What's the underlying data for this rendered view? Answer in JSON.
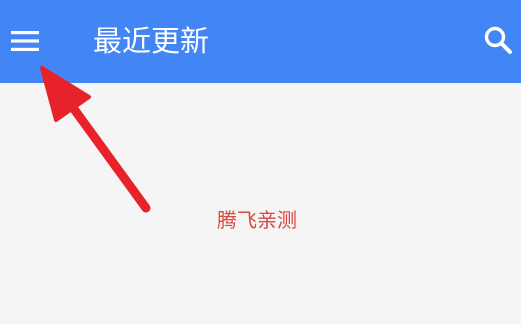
{
  "app_bar": {
    "title": "最近更新",
    "background_color": "#4285f4",
    "menu_icon": "hamburger-menu-icon",
    "search_icon": "search-icon"
  },
  "content": {
    "background_color": "#f5f5f5",
    "watermark_text": "腾飞亲测",
    "watermark_color": "#d9463e"
  },
  "annotation": {
    "arrow_color": "#e8222b",
    "points_to": "menu-button"
  }
}
